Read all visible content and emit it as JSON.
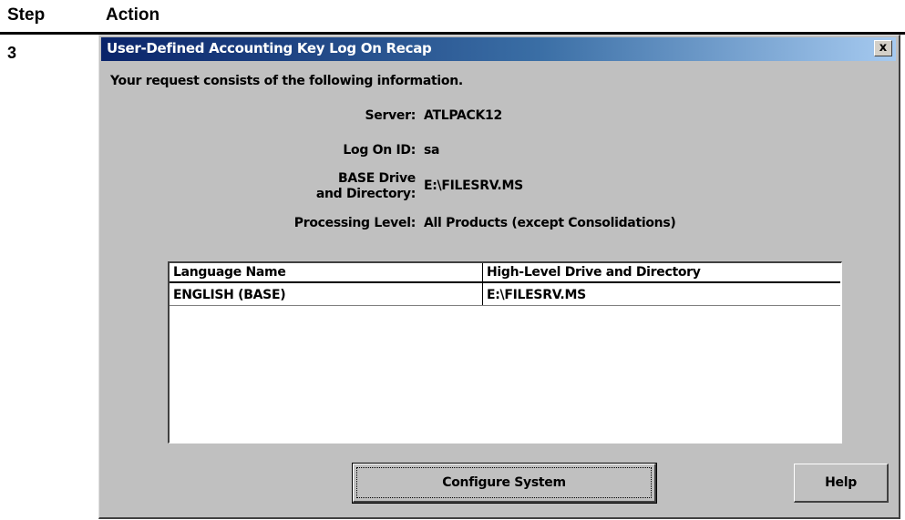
{
  "document": {
    "columns": {
      "step": "Step",
      "action": "Action"
    },
    "step_number": "3"
  },
  "dialog": {
    "title": "User-Defined Accounting Key Log On Recap",
    "close_glyph": "x",
    "intro": "Your request consists of the following information.",
    "fields": {
      "server": {
        "label": "Server:",
        "value": "ATLPACK12"
      },
      "logon_id": {
        "label": "Log On ID:",
        "value": "sa"
      },
      "base_drive": {
        "label_line1": "BASE Drive",
        "label_line2": "and Directory:",
        "value": "E:\\FILESRV.MS"
      },
      "processing_level": {
        "label": "Processing Level:",
        "value": "All Products (except Consolidations)"
      }
    },
    "grid": {
      "headers": {
        "language": "Language Name",
        "directory": "High-Level Drive and Directory"
      },
      "rows": [
        {
          "language": "ENGLISH  (BASE)",
          "directory": "E:\\FILESRV.MS"
        }
      ]
    },
    "buttons": {
      "configure": "Configure System",
      "help": "Help"
    }
  }
}
